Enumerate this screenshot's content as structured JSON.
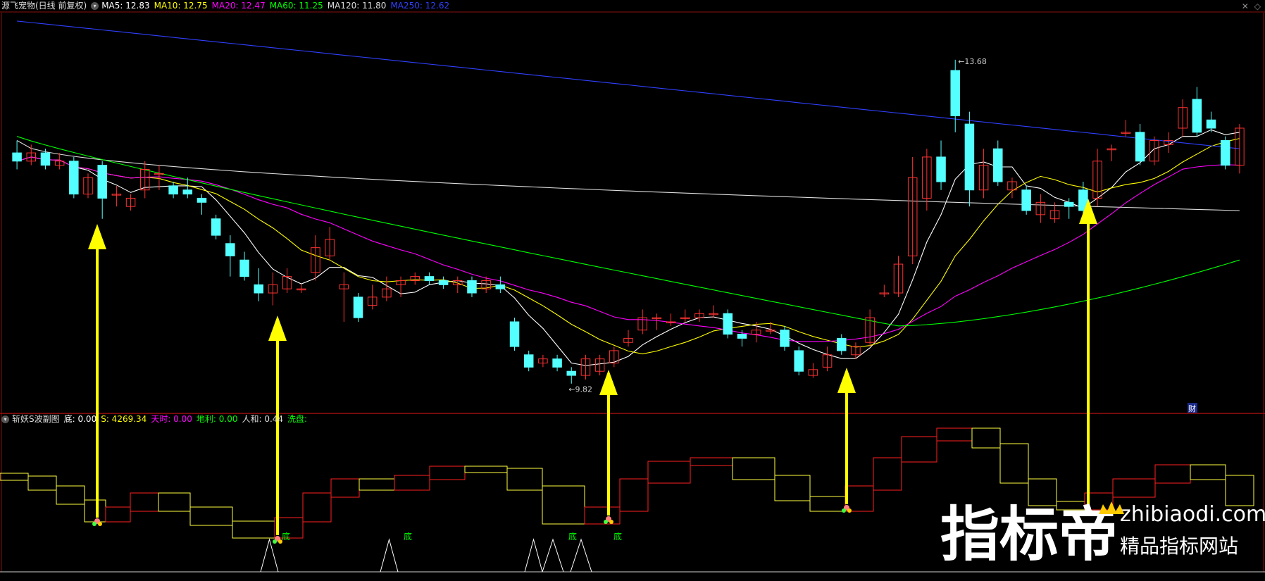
{
  "header_main": {
    "title": "源飞宠物(日线 前复权)",
    "ma_items": [
      {
        "label": "MA5: 12.83",
        "color": "#ffffff"
      },
      {
        "label": "MA10: 12.75",
        "color": "#ffff00"
      },
      {
        "label": "MA20: 12.47",
        "color": "#ff00ff"
      },
      {
        "label": "MA60: 11.25",
        "color": "#00ff00"
      },
      {
        "label": "MA120: 11.80",
        "color": "#dddddd"
      },
      {
        "label": "MA250: 12.62",
        "color": "#3040ff"
      }
    ]
  },
  "header_sub": {
    "title": "斩妖S波副图",
    "items": [
      {
        "label": "底: 0.00",
        "color": "#ffffff"
      },
      {
        "label": "S: 4269.34",
        "color": "#ffff00"
      },
      {
        "label": "天时: 0.00",
        "color": "#ff00ff"
      },
      {
        "label": "地利: 0.00",
        "color": "#00ff00"
      },
      {
        "label": "人和: 0.44",
        "color": "#dddddd"
      },
      {
        "label": "洗盘:",
        "color": "#00ff00"
      }
    ]
  },
  "corner_icons": [
    "close-icon",
    "diamond-icon"
  ],
  "price_markers": {
    "high": "13.68",
    "low": "9.82"
  },
  "caifu_badge": "财",
  "di_labels": [
    "底",
    "底",
    "底",
    "底"
  ],
  "watermark": {
    "big": "指标帝",
    "url": "zhibiaodi.com",
    "tagline": "精品指标网站"
  },
  "chart_data": {
    "type": "candlestick",
    "price_range": [
      9.5,
      14.2
    ],
    "candles": [
      [
        12.55,
        12.45,
        12.7,
        12.35
      ],
      [
        12.45,
        12.55,
        12.65,
        12.4
      ],
      [
        12.55,
        12.4,
        12.6,
        12.35
      ],
      [
        12.4,
        12.45,
        12.55,
        12.35
      ],
      [
        12.45,
        12.05,
        12.5,
        12.0
      ],
      [
        12.05,
        12.25,
        12.3,
        12.0
      ],
      [
        12.4,
        12.0,
        12.45,
        11.75
      ],
      [
        12.05,
        12.05,
        12.15,
        11.9
      ],
      [
        11.9,
        12.0,
        12.05,
        11.85
      ],
      [
        12.1,
        12.35,
        12.45,
        12.0
      ],
      [
        12.3,
        12.3,
        12.4,
        12.1
      ],
      [
        12.15,
        12.05,
        12.2,
        12.0
      ],
      [
        12.1,
        12.05,
        12.25,
        12.0
      ],
      [
        12.0,
        11.95,
        12.05,
        11.8
      ],
      [
        11.75,
        11.55,
        11.8,
        11.5
      ],
      [
        11.45,
        11.3,
        11.55,
        11.05
      ],
      [
        11.25,
        11.05,
        11.35,
        11.0
      ],
      [
        10.95,
        10.85,
        11.15,
        10.75
      ],
      [
        10.85,
        10.95,
        11.1,
        10.7
      ],
      [
        10.9,
        11.05,
        11.15,
        10.85
      ],
      [
        10.9,
        10.9,
        10.95,
        10.85
      ],
      [
        11.1,
        11.4,
        11.55,
        11.0
      ],
      [
        11.3,
        11.5,
        11.65,
        11.25
      ],
      [
        10.9,
        10.95,
        11.1,
        10.5
      ],
      [
        10.8,
        10.55,
        10.85,
        10.5
      ],
      [
        10.7,
        10.8,
        10.95,
        10.65
      ],
      [
        10.8,
        10.9,
        11.05,
        10.75
      ],
      [
        10.95,
        11.0,
        11.05,
        10.8
      ],
      [
        11.0,
        11.05,
        11.1,
        10.95
      ],
      [
        11.05,
        11.0,
        11.1,
        10.95
      ],
      [
        11.0,
        10.95,
        11.05,
        10.9
      ],
      [
        10.95,
        11.0,
        11.05,
        10.85
      ],
      [
        11.0,
        10.85,
        11.05,
        10.8
      ],
      [
        10.9,
        11.0,
        11.05,
        10.85
      ],
      [
        10.95,
        10.9,
        11.05,
        10.85
      ],
      [
        10.5,
        10.2,
        10.55,
        10.15
      ],
      [
        10.1,
        9.95,
        10.15,
        9.9
      ],
      [
        10.0,
        10.05,
        10.1,
        9.95
      ],
      [
        10.05,
        9.95,
        10.1,
        9.9
      ],
      [
        9.9,
        9.85,
        9.95,
        9.75
      ],
      [
        9.85,
        10.05,
        10.1,
        9.8
      ],
      [
        9.9,
        10.05,
        10.1,
        9.85
      ],
      [
        10.0,
        10.15,
        10.2,
        9.95
      ],
      [
        10.25,
        10.3,
        10.4,
        10.2
      ],
      [
        10.4,
        10.55,
        10.65,
        10.35
      ],
      [
        10.55,
        10.55,
        10.6,
        10.4
      ],
      [
        10.5,
        10.5,
        10.6,
        10.45
      ],
      [
        10.55,
        10.55,
        10.65,
        10.5
      ],
      [
        10.55,
        10.6,
        10.65,
        10.5
      ],
      [
        10.6,
        10.6,
        10.7,
        10.55
      ],
      [
        10.6,
        10.35,
        10.65,
        10.3
      ],
      [
        10.35,
        10.3,
        10.4,
        10.2
      ],
      [
        10.35,
        10.4,
        10.5,
        10.25
      ],
      [
        10.4,
        10.4,
        10.5,
        10.35
      ],
      [
        10.4,
        10.2,
        10.45,
        10.15
      ],
      [
        10.15,
        9.9,
        10.2,
        9.85
      ],
      [
        9.85,
        9.92,
        10.0,
        9.82
      ],
      [
        9.95,
        10.1,
        10.2,
        9.9
      ],
      [
        10.3,
        10.15,
        10.35,
        10.1
      ],
      [
        10.1,
        10.2,
        10.25,
        10.05
      ],
      [
        10.25,
        10.55,
        10.65,
        10.2
      ],
      [
        10.85,
        10.85,
        10.95,
        10.8
      ],
      [
        10.85,
        11.2,
        11.3,
        10.8
      ],
      [
        11.3,
        12.25,
        12.5,
        11.2
      ],
      [
        12.0,
        12.5,
        12.6,
        11.85
      ],
      [
        12.5,
        12.2,
        12.7,
        12.1
      ],
      [
        13.55,
        13.0,
        13.68,
        12.8
      ],
      [
        12.9,
        12.1,
        13.05,
        11.9
      ],
      [
        12.1,
        12.4,
        12.6,
        12.0
      ],
      [
        12.6,
        12.2,
        12.7,
        12.15
      ],
      [
        12.1,
        12.2,
        12.25,
        12.0
      ],
      [
        12.1,
        11.85,
        12.15,
        11.8
      ],
      [
        11.8,
        11.95,
        12.05,
        11.7
      ],
      [
        11.75,
        11.85,
        11.95,
        11.7
      ],
      [
        11.95,
        11.9,
        12.0,
        11.75
      ],
      [
        12.1,
        11.85,
        12.2,
        11.8
      ],
      [
        12.0,
        12.45,
        12.6,
        11.9
      ],
      [
        12.6,
        12.6,
        12.65,
        12.45
      ],
      [
        12.8,
        12.8,
        12.95,
        12.75
      ],
      [
        12.8,
        12.45,
        12.9,
        12.4
      ],
      [
        12.45,
        12.7,
        12.75,
        12.4
      ],
      [
        12.65,
        12.7,
        12.8,
        12.55
      ],
      [
        12.85,
        13.1,
        13.2,
        12.75
      ],
      [
        13.2,
        12.8,
        13.35,
        12.75
      ],
      [
        12.95,
        12.85,
        13.05,
        12.8
      ],
      [
        12.7,
        12.4,
        12.75,
        12.35
      ],
      [
        12.4,
        12.85,
        12.9,
        12.3
      ]
    ]
  }
}
